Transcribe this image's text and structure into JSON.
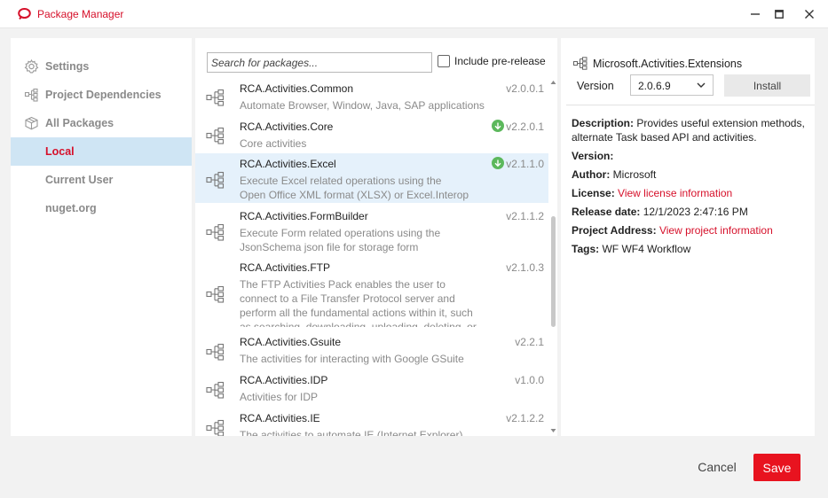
{
  "window": {
    "title": "Package Manager",
    "accent_color": "#d6102a",
    "minimize_icon": "minimize-icon",
    "maximize_icon": "maximize-icon",
    "close_icon": "close-icon"
  },
  "nav": {
    "items": [
      {
        "label": "Settings",
        "icon": "gear-icon",
        "active": false
      },
      {
        "label": "Project Dependencies",
        "icon": "dependency-icon",
        "active": false
      },
      {
        "label": "All Packages",
        "icon": "packages-icon",
        "active": false
      },
      {
        "label": "Local",
        "icon": "",
        "active": true
      },
      {
        "label": "Current User",
        "icon": "",
        "active": false
      },
      {
        "label": "nuget.org",
        "icon": "",
        "active": false
      }
    ]
  },
  "search": {
    "placeholder": "Search for packages...",
    "value": "",
    "prerelease_label": "Include pre-release",
    "prerelease_checked": false
  },
  "packages": [
    {
      "name": "RCA.Activities.Common",
      "description": "Automate Browser, Window, Java, SAP applications",
      "version": "v2.0.0.1",
      "update_available": false
    },
    {
      "name": "RCA.Activities.Core",
      "description": "Core activities",
      "version": "v2.2.0.1",
      "update_available": true
    },
    {
      "name": "RCA.Activities.Excel",
      "description": "Execute Excel related operations using the Open Office XML format (XLSX) or Excel.Interop",
      "version": "v2.1.1.0",
      "update_available": true,
      "selected": true
    },
    {
      "name": "RCA.Activities.FormBuilder",
      "description": "Execute Form related operations using the JsonSchema json file for storage form",
      "version": "v2.1.1.2",
      "update_available": false
    },
    {
      "name": "RCA.Activities.FTP",
      "description": "The FTP Activities Pack enables the user to connect to a File Transfer Protocol server and perform all the fundamental actions within it, such as searching, downloading, uploading, deleting, or",
      "version": "v2.1.0.3",
      "update_available": false
    },
    {
      "name": "RCA.Activities.Gsuite",
      "description": "The activities for interacting with Google GSuite",
      "version": "v2.2.1",
      "update_available": false
    },
    {
      "name": "RCA.Activities.IDP",
      "description": "Activities for IDP",
      "version": "v1.0.0",
      "update_available": false
    },
    {
      "name": "RCA.Activities.IE",
      "description": "The activities to automate IE (Internet Explorer)",
      "version": "v2.1.2.2",
      "update_available": false
    }
  ],
  "details": {
    "package_name": "Microsoft.Activities.Extensions",
    "version_label": "Version",
    "version_value": "2.0.6.9",
    "install_label": "Install",
    "description_label": "Description:",
    "description": "Provides useful extension methods, alternate Task based API and activities.",
    "version_info_label": "Version:",
    "author_label": "Author:",
    "author": "Microsoft",
    "license_label": "License:",
    "license_link": "View license information",
    "release_label": "Release date:",
    "release_date": "12/1/2023 2:47:16 PM",
    "project_label": "Project Address:",
    "project_link": "View project information",
    "tags_label": "Tags:",
    "tags": "WF WF4 Workflow"
  },
  "footer": {
    "cancel_label": "Cancel",
    "save_label": "Save",
    "save_color": "#e8131f"
  }
}
